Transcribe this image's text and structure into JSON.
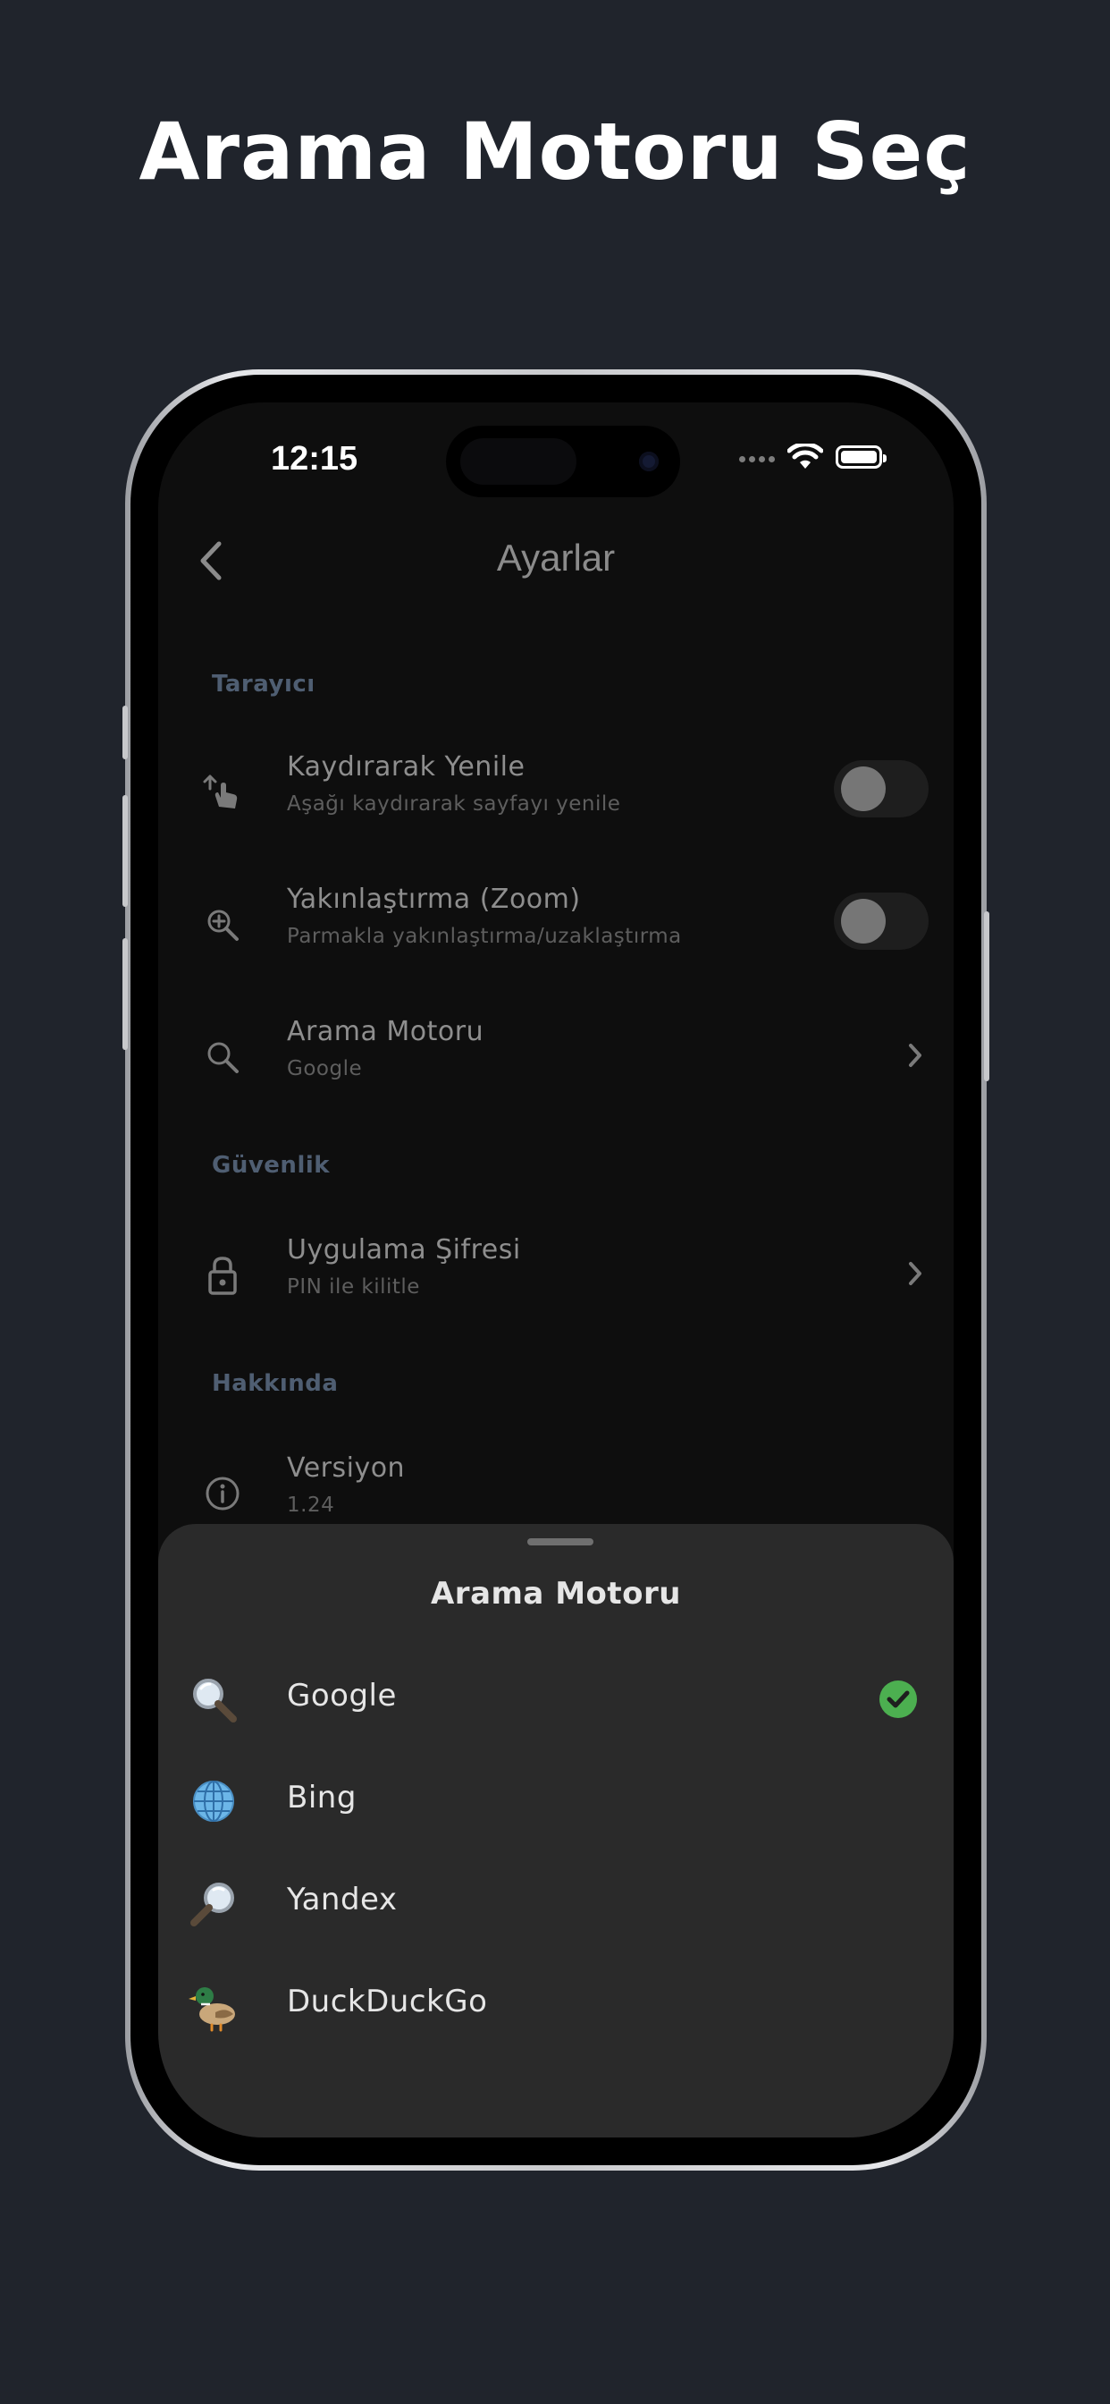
{
  "promo": {
    "title": "Arama Motoru Seç"
  },
  "status_bar": {
    "time": "12:15"
  },
  "nav": {
    "title": "Ayarlar",
    "back_icon": "chevron-left-icon"
  },
  "sections": [
    {
      "header": "Tarayıcı",
      "rows": [
        {
          "title": "Kaydırarak Yenile",
          "subtitle": "Aşağı kaydırarak sayfayı yenile",
          "icon": "swipe-gesture-icon",
          "control": "toggle",
          "on": false
        },
        {
          "title": "Yakınlaştırma (Zoom)",
          "subtitle": "Parmakla yakınlaştırma/uzaklaştırma",
          "icon": "zoom-in-icon",
          "control": "toggle",
          "on": false
        },
        {
          "title": "Arama Motoru",
          "subtitle": "Google",
          "icon": "search-icon",
          "control": "chevron"
        }
      ]
    },
    {
      "header": "Güvenlik",
      "rows": [
        {
          "title": "Uygulama Şifresi",
          "subtitle": "PIN ile kilitle",
          "icon": "lock-icon",
          "control": "chevron"
        }
      ]
    },
    {
      "header": "Hakkında",
      "rows": [
        {
          "title": "Versiyon",
          "subtitle": "1.24",
          "icon": "info-icon",
          "control": "none"
        }
      ]
    }
  ],
  "sheet": {
    "title": "Arama Motoru",
    "options": [
      {
        "label": "Google",
        "icon": "magnifier-emoji-icon",
        "selected": true
      },
      {
        "label": "Bing",
        "icon": "globe-emoji-icon",
        "selected": false
      },
      {
        "label": "Yandex",
        "icon": "magnifier-right-emoji-icon",
        "selected": false
      },
      {
        "label": "DuckDuckGo",
        "icon": "duck-emoji-icon",
        "selected": false
      }
    ]
  },
  "colors": {
    "background": "#20242c",
    "screen": "#0e0e0e",
    "sheet": "#2a2a2a",
    "section_header": "#4f5e72",
    "check": "#4caf50"
  }
}
